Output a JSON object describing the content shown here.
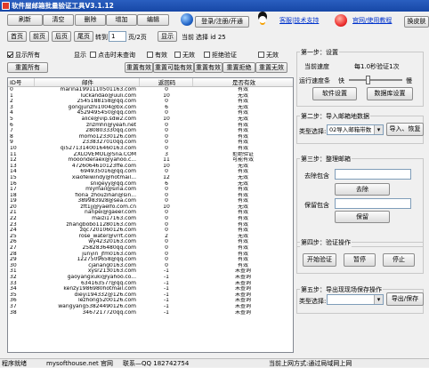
{
  "window": {
    "title": "软件屋邮箱批量验证工具V3.1.12"
  },
  "toolbar": {
    "refresh": "刷新",
    "clear": "清空",
    "delete": "删除",
    "add": "增加",
    "edit": "编辑",
    "login_link": "登录/注册/开通",
    "support_link": "客服|技术支持",
    "official_link": "官网/使用教程",
    "skin_button": "换皮肤"
  },
  "pager": {
    "home": "首页",
    "prev": "前页",
    "next": "后页",
    "last": "尾页",
    "goto_label": "转到",
    "goto_value": "1",
    "page_info": "页/2页",
    "show_button": "显示",
    "current_label": "当前",
    "selected": "选择 id 25"
  },
  "filters": {
    "show_all": "显示所有",
    "display_label": "显示",
    "click_query": "点击时未查询",
    "valid": "有效",
    "invalid": "无效",
    "verify_refused": "拒绝验证",
    "none": "无效",
    "reset_all": "重置所有",
    "reset_valid": "重置有效",
    "reset_maybe_valid": "重置可能有效",
    "reset_valid2": "重置有效",
    "reset_refused": "重置拒绝",
    "reset_invalid": "重置无效"
  },
  "table": {
    "headers": [
      "ID号",
      "邮件",
      "返回码",
      "是否有效"
    ],
    "rows": [
      [
        "0",
        "marina1991110501163.com",
        "0",
        "有效"
      ],
      [
        "1",
        "luckandao@uuli.com",
        "10",
        "无效"
      ],
      [
        "2",
        "2545188158@qq.com",
        "0",
        "有效"
      ],
      [
        "3",
        "gongjunzhi1004@bx.com",
        "6",
        "无效"
      ],
      [
        "4",
        "4529495450@qq.com",
        "0",
        "有效"
      ],
      [
        "5",
        "alice@vip.sdw2.com",
        "10",
        "无效"
      ],
      [
        "6",
        "znzmhn@yeah.net",
        "0",
        "有效"
      ],
      [
        "7",
        "280803330qq.com",
        "0",
        "有效"
      ],
      [
        "8",
        "momo12330126.com",
        "0",
        "有效"
      ],
      [
        "9",
        "2338327010qq.com",
        "0",
        "有效"
      ],
      [
        "10",
        "qi52713140016460163.com",
        "0",
        "有效"
      ],
      [
        "11",
        "ZXLOVEMOL@Sna.COM",
        "3",
        "拒绝验证"
      ],
      [
        "12",
        "mooonderaex@yahoo.c...",
        "11",
        "可能有效"
      ],
      [
        "13",
        "4726064610123ffe.com",
        "10",
        "无效"
      ],
      [
        "14",
        "694935016@qq.com",
        "0",
        "有效"
      ],
      [
        "15",
        "xiaofeiwindy@hotmail...",
        "12",
        "无效"
      ],
      [
        "16",
        "snigeyy@qq.com",
        "6",
        "无效"
      ],
      [
        "17",
        "mlymail@sina.com",
        "0",
        "有效"
      ],
      [
        "18",
        "fiona_zhouzihan@sin...",
        "0",
        "有效"
      ],
      [
        "19",
        "389983928@sea.com",
        "0",
        "有效"
      ],
      [
        "20",
        "zft1jj@yaelfo.com.cn",
        "10",
        "无效"
      ],
      [
        "21",
        "nanpei@gaeer.com",
        "0",
        "有效"
      ],
      [
        "22",
        "maizi17163.com",
        "0",
        "有效"
      ],
      [
        "23",
        "zhangbobo11280163.com",
        "0",
        "有效"
      ],
      [
        "24",
        "zqc7201060126.com",
        "0",
        "有效"
      ],
      [
        "25",
        "rose_water@vrrt.com",
        "2",
        "无效"
      ],
      [
        "26",
        "wy42320163.com",
        "0",
        "有效"
      ],
      [
        "27",
        "2582836480qq.com",
        "0",
        "有效"
      ],
      [
        "28",
        "junyin_jfm0163.com",
        "0",
        "有效"
      ],
      [
        "29",
        "1227509658@qq.com",
        "0",
        "有效"
      ],
      [
        "30",
        "cjanang0163.com",
        "0",
        "有效"
      ],
      [
        "31",
        "xysr2130163.com",
        "-1",
        "未查询"
      ],
      [
        "32",
        "gaoyangxuki@yahoo.co...",
        "-1",
        "未查询"
      ],
      [
        "33",
        "63416357?@qq.com",
        "-1",
        "未查询"
      ],
      [
        "34",
        "kenzy1986980hotmail.com",
        "-1",
        "未查询"
      ],
      [
        "35",
        "dieyi194332@126.com",
        "-1",
        "未查询"
      ],
      [
        "36",
        "lezhong5200126.com",
        "-1",
        "未查询"
      ],
      [
        "37",
        "wangyang53824490126.com",
        "-1",
        "未查询"
      ],
      [
        "38",
        "3467217720qq.com",
        "-1",
        "未查询"
      ]
    ]
  },
  "step1": {
    "title": "第一步：设置",
    "speed_label": "当前速度",
    "speed_value": "每1.0秒验证1次",
    "speed_ctrl": "运行速度条",
    "fast": "快",
    "slow": "慢",
    "speed_level": 0.35,
    "software_settings": "软件设置",
    "db_settings": "数据库设置"
  },
  "step2": {
    "title": "第二步：导入邮箱地数据",
    "type_label": "类型选择:",
    "type_value": "02导入邮箱带数",
    "import_button": "导入、恢复"
  },
  "step3": {
    "title": "第三步：整理邮箱",
    "remove_label": "去除包含",
    "remove_button": "去除",
    "keep_label": "保留包含",
    "keep_button": "保留"
  },
  "step4": {
    "title": "第四步：验证操作",
    "start": "开始验证",
    "pause": "暂停",
    "stop": "停止"
  },
  "step5": {
    "title": "第五步：导出现现场保存操作",
    "type_label": "类型选择:",
    "export_button": "导出/保存"
  },
  "status": {
    "ready": "程序就绪",
    "site": "mysofthouse.net 官网",
    "contact": "联系—QQ 182742754",
    "mode": "当前上网方式:通过局域网上网"
  }
}
